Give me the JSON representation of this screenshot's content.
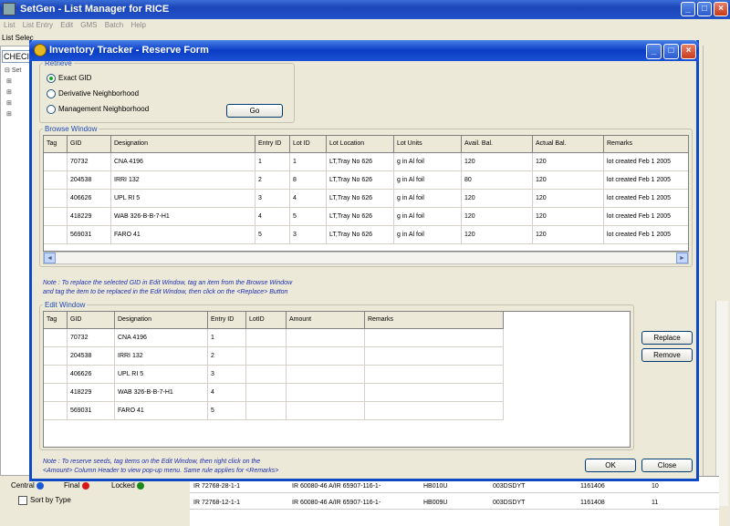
{
  "app": {
    "title": "SetGen - List Manager for RICE",
    "menu": [
      "List",
      "List Entry",
      "Edit",
      "GMS",
      "Batch",
      "Help"
    ],
    "left_tab": "List Selec",
    "combo_value": "CHECI",
    "tree_root": "Set"
  },
  "legend": {
    "central": "Central",
    "final": "Final",
    "locked": "Locked",
    "sort_label": "Sort by Type"
  },
  "background_rows": [
    [
      "IR 72768-28-1-1",
      "IR 60080-46 A/IR 65907-116-1-",
      "HB010U",
      "003DSDYT",
      "1161406",
      "10"
    ],
    [
      "IR 72768-12-1-1",
      "IR 60080-46 A/IR 65907-116-1-",
      "HB009U",
      "003DSDYT",
      "1161408",
      "11"
    ]
  ],
  "dialog": {
    "title": "Inventory Tracker - Reserve Form",
    "retrieve": {
      "legend": "Retrieve",
      "options": [
        "Exact GID",
        "Derivative Neighborhood",
        "Management Neighborhood"
      ],
      "selected": "Exact GID",
      "go_label": "Go"
    },
    "browse": {
      "legend": "Browse Window",
      "columns": [
        "Tag",
        "GID",
        "Designation",
        "Entry ID",
        "Lot ID",
        "Lot Location",
        "Lot Units",
        "Avail. Bal.",
        "Actual Bal.",
        "Remarks"
      ],
      "rows": [
        [
          "",
          "70732",
          "CNA 4196",
          "1",
          "1",
          "LT,Tray No 626",
          "g in Al foil",
          "120",
          "120",
          "lot created Feb 1 2005"
        ],
        [
          "",
          "204538",
          "IRRI 132",
          "2",
          "8",
          "LT,Tray No 626",
          "g in Al foil",
          "80",
          "120",
          "lot created Feb 1 2005"
        ],
        [
          "",
          "406626",
          "UPL RI 5",
          "3",
          "4",
          "LT,Tray No 626",
          "g in Al foil",
          "120",
          "120",
          "lot created Feb 1 2005"
        ],
        [
          "",
          "418229",
          "WAB 326-B-B-7-H1",
          "4",
          "5",
          "LT,Tray No 626",
          "g in Al foil",
          "120",
          "120",
          "lot created Feb 1 2005"
        ],
        [
          "",
          "569031",
          "FARO 41",
          "5",
          "3",
          "LT,Tray No 626",
          "g in Al foil",
          "120",
          "120",
          "lot created Feb 1 2005"
        ]
      ]
    },
    "note_top": [
      "Note : To replace the selected GID in Edit Window, tag an item from the Browse Window",
      "and tag  the item to be replaced in the Edit Window, then click on the <Replace> Button"
    ],
    "edit": {
      "legend": "Edit Window",
      "columns": [
        "Tag",
        "GID",
        "Designation",
        "Entry ID",
        "LotID",
        "Amount",
        "Remarks"
      ],
      "rows": [
        [
          "",
          "70732",
          "CNA 4196",
          "1",
          "",
          "",
          ""
        ],
        [
          "",
          "204538",
          "IRRI 132",
          "2",
          "",
          "",
          ""
        ],
        [
          "",
          "406626",
          "UPL RI 5",
          "3",
          "",
          "",
          ""
        ],
        [
          "",
          "418229",
          "WAB 326-B-B-7-H1",
          "4",
          "",
          "",
          ""
        ],
        [
          "",
          "569031",
          "FARO 41",
          "5",
          "",
          "",
          ""
        ]
      ],
      "replace_label": "Replace",
      "remove_label": "Remove"
    },
    "note_bottom": [
      "Note : To reserve seeds, tag items on the Edit Window, then right click on the",
      "<Amount> Column Header to view pop-up menu. Same rule applies for <Remarks>"
    ],
    "ok_label": "OK",
    "close_label": "Close"
  }
}
